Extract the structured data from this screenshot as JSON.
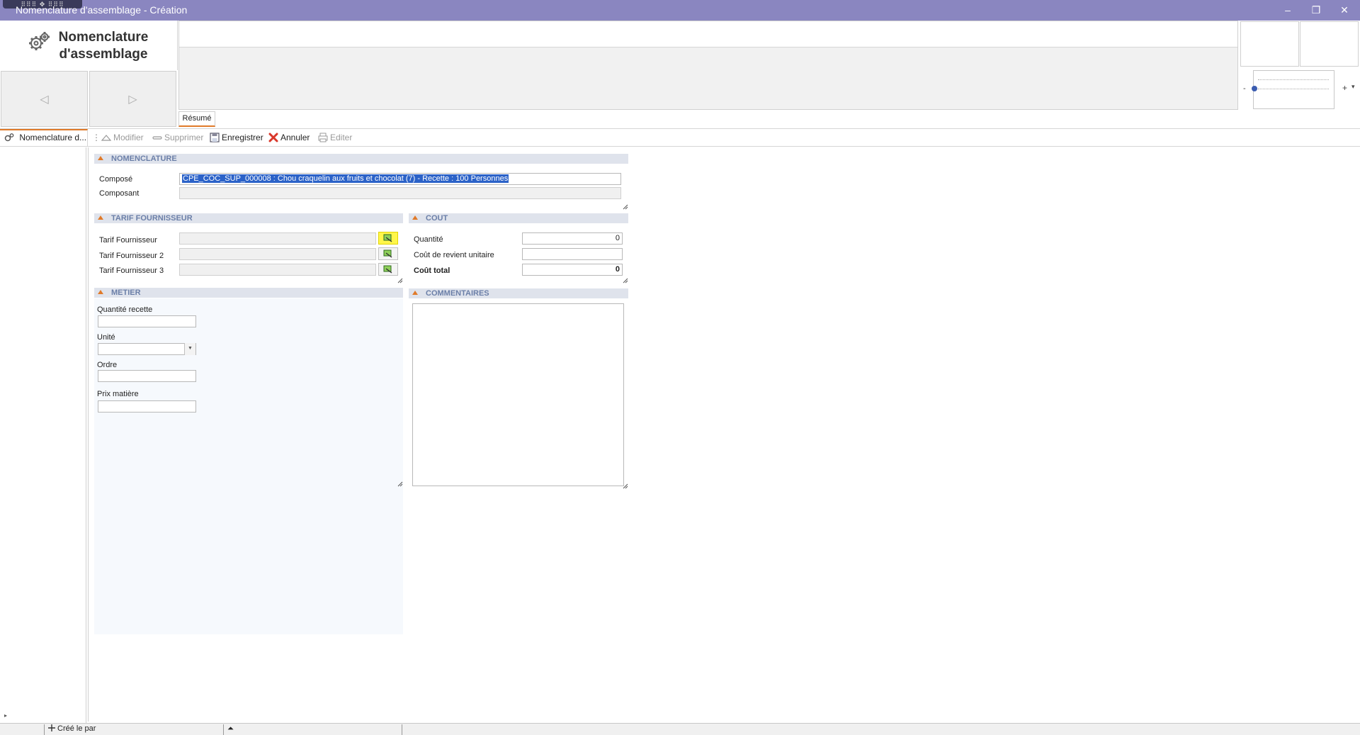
{
  "window": {
    "title": "Nomenclature d'assemblage - Création",
    "minimize_glyph": "–",
    "restore_glyph": "❐",
    "close_glyph": "✕",
    "grip_glyph": "⠿⠿⠿ ✥ ⠿⠿⠿"
  },
  "header": {
    "logo_line1": "Nomenclature",
    "logo_line2": "d'assemblage",
    "prev_glyph": "◁",
    "next_glyph": "▷",
    "tab_resume": "Résumé",
    "zoom_minus": "-",
    "zoom_plus": "+",
    "zoom_drop": "▾"
  },
  "toolbar": {
    "doc_tab": "Nomenclature d...",
    "separator": "⋮",
    "modifier": "Modifier",
    "supprimer": "Supprimer",
    "enregistrer": "Enregistrer",
    "annuler": "Annuler",
    "editer": "Editer"
  },
  "nomenclature": {
    "header": "NOMENCLATURE",
    "compose_label": "Composé",
    "compose_value": "CPE_COC_SUP_000008 : Chou craquelin aux fruits et chocolat (7)  - Recette : 100  Personnes",
    "composant_label": "Composant",
    "composant_value": ""
  },
  "tarif": {
    "header": "TARIF FOURNISSEUR",
    "tarif1_label": "Tarif Fournisseur",
    "tarif2_label": "Tarif Fournisseur 2",
    "tarif3_label": "Tarif Fournisseur 3"
  },
  "cout": {
    "header": "COUT",
    "quantite_label": "Quantité",
    "quantite_value": "0",
    "cout_unitaire_label": "Coût de revient unitaire",
    "cout_unitaire_value": "",
    "cout_total_label": "Coût total",
    "cout_total_value": "0"
  },
  "metier": {
    "header": "METIER",
    "quantite_recette_label": "Quantité recette",
    "unite_label": "Unité",
    "ordre_label": "Ordre",
    "prix_matiere_label": "Prix matière",
    "combo_glyph": "▼"
  },
  "commentaires": {
    "header": "COMMENTAIRES"
  },
  "left_nav": {
    "expand_glyph": "▸"
  },
  "status": {
    "created_text": "Créé le  par",
    "up_glyph": "⏶"
  },
  "colors": {
    "titlebar": "#8a86c0",
    "accent": "#e07a2a",
    "section_text": "#6b7fa8",
    "highlight": "#fff64a",
    "selection": "#2b62c8"
  }
}
